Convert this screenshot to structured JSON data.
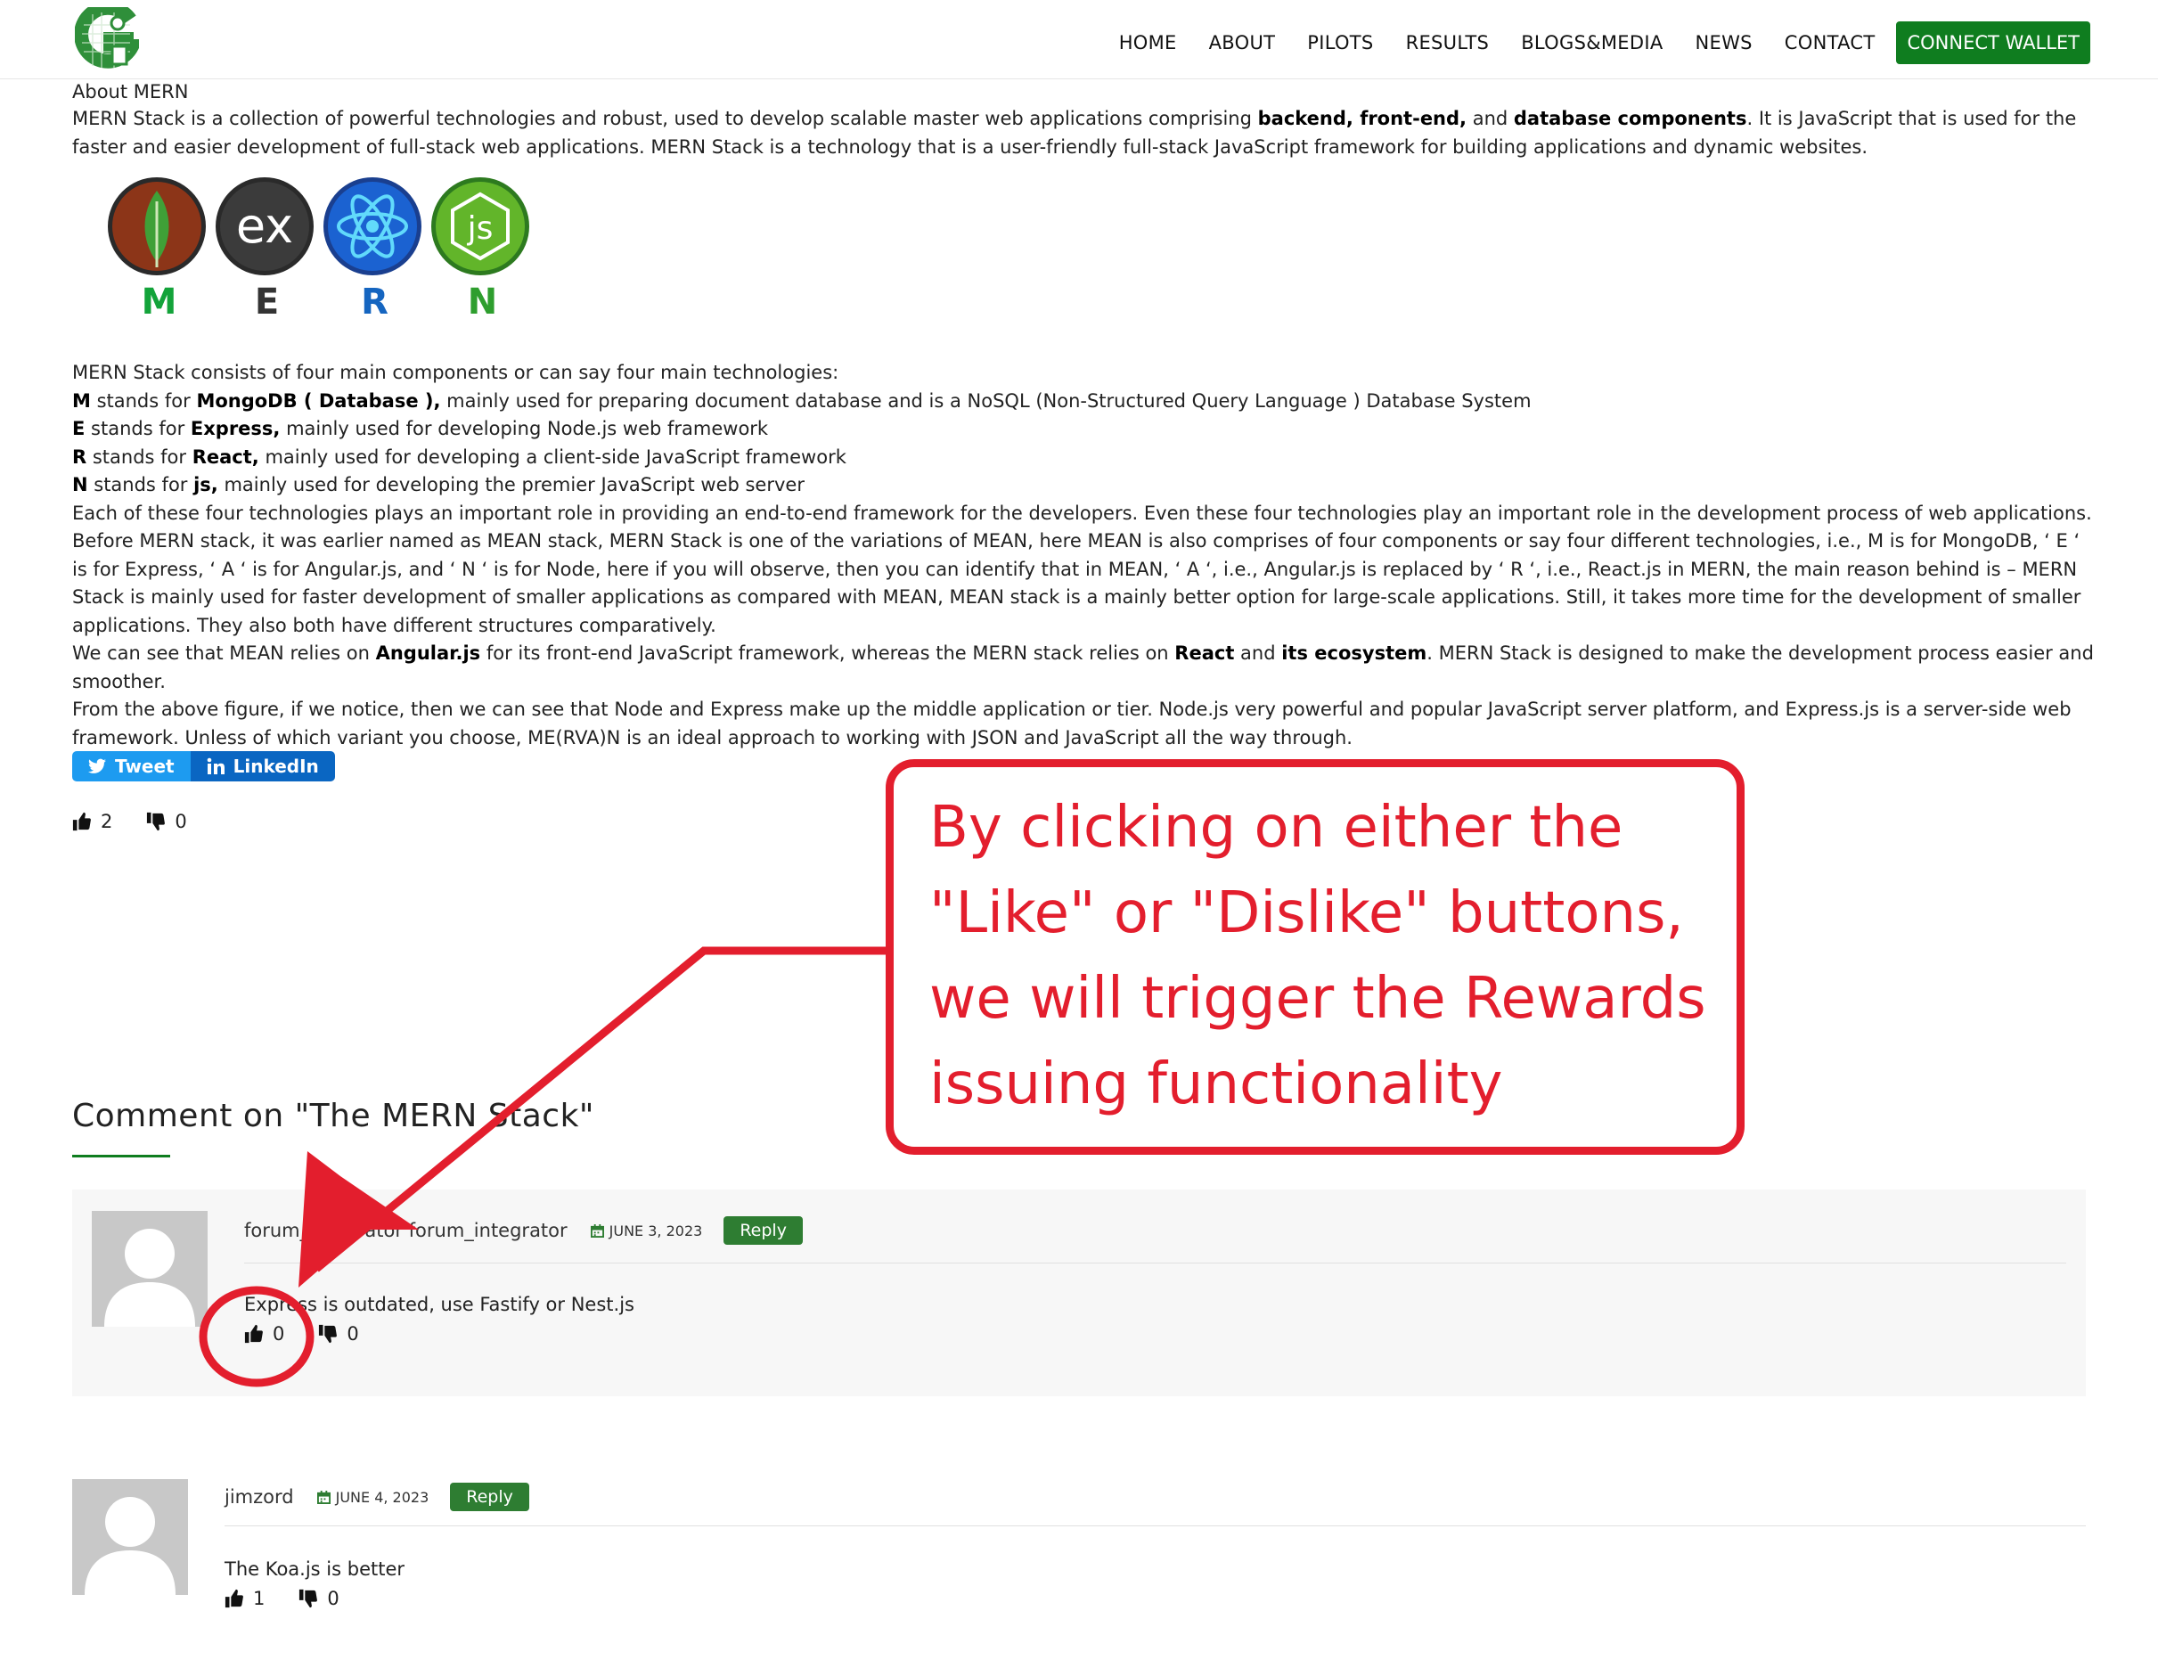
{
  "header": {
    "nav": [
      "HOME",
      "ABOUT",
      "PILOTS",
      "RESULTS",
      "BLOGS&MEDIA",
      "NEWS",
      "CONTACT"
    ],
    "connect_wallet": "CONNECT WALLET"
  },
  "article": {
    "breadcrumb": "About MERN",
    "intro_a": "MERN Stack is a collection of powerful technologies and robust, used to develop scalable master web applications comprising ",
    "intro_b1": "backend, front-end,",
    "intro_and": " and ",
    "intro_b2": "database components",
    "intro_c": ". It is JavaScript that is used for the faster and easier development of full-stack web applications. MERN Stack is a technology that is a user-friendly full-stack JavaScript framework for building applications and dynamic websites.",
    "stack_letters": [
      "M",
      "E",
      "R",
      "N"
    ],
    "stack_colors": [
      "#13a33a",
      "#333333",
      "#1565c0",
      "#2e9e2e"
    ],
    "components_intro": "MERN Stack consists of four main components or can say four main technologies:",
    "m_letter": "M",
    "m_mid": " stands for ",
    "m_name": "MongoDB ( Database ),",
    "m_desc": " mainly used for preparing document database and is a NoSQL (Non-Structured Query Language ) Database System",
    "e_letter": "E",
    "e_mid": " stands for ",
    "e_name": "Express,",
    "e_desc": " mainly used for developing Node.js web framework",
    "r_letter": "R",
    "r_mid": " stands for ",
    "r_name": "React,",
    "r_desc": " mainly used for developing a client-side JavaScript framework",
    "n_letter": "N",
    "n_mid": " stands for ",
    "n_name": "js,",
    "n_desc": " mainly used for developing the premier JavaScript web server",
    "para_each": "Each of these four technologies plays an important role in providing an end-to-end framework for the developers. Even these four technologies play an important role in the development process of web applications. Before MERN stack, it was earlier named as MEAN stack, MERN Stack is one of the variations of MEAN, here MEAN is also comprises of four components or say four different technologies, i.e., M is for MongoDB, ‘ E ‘ is for Express, ‘ A ‘ is for Angular.js, and ‘ N ‘ is for Node, here if you will observe, then you can identify that in MEAN, ‘ A ‘, i.e., Angular.js is replaced by ‘ R ‘, i.e., React.js in MERN, the main reason behind is – MERN Stack is mainly used for faster development of smaller applications as compared with MEAN, MEAN stack is a mainly better option for large-scale applications. Still, it takes more time for the development of smaller applications. They also both have different structures comparatively.",
    "mean_a": "We can see that MEAN relies on ",
    "mean_b1": "Angular.js",
    "mean_b": " for its front-end JavaScript framework, whereas the MERN stack relies on ",
    "mean_b2": "React",
    "mean_and": " and ",
    "mean_b3": "its ecosystem",
    "mean_c": ". MERN Stack is designed to make the development process easier and smoother.",
    "para_figure": "From the above figure, if we notice, then we can see that Node and Express make up the middle application or tier. Node.js very powerful and popular JavaScript server platform, and Express.js is a server-side web framework. Unless of which variant you choose, ME(RVA)N is an ideal approach to working with JSON and JavaScript all the way through.",
    "tweet": "Tweet",
    "linkedin": "LinkedIn",
    "likes": "2",
    "dislikes": "0"
  },
  "comments": {
    "title": "Comment on \"The MERN Stack\"",
    "items": [
      {
        "author": "forum_integrator forum_integrator",
        "date": "JUNE 3, 2023",
        "reply": "Reply",
        "text": "Express is outdated, use Fastify or Nest.js",
        "likes": "0",
        "dislikes": "0"
      },
      {
        "author": "jimzord",
        "date": "JUNE 4, 2023",
        "reply": "Reply",
        "text": "The Koa.js is better",
        "likes": "1",
        "dislikes": "0"
      }
    ]
  },
  "annotation": {
    "text": "By clicking on either the \"Like\" or \"Dislike\" buttons, we will trigger the Rewards issuing functionality",
    "color": "#e31e2d"
  }
}
